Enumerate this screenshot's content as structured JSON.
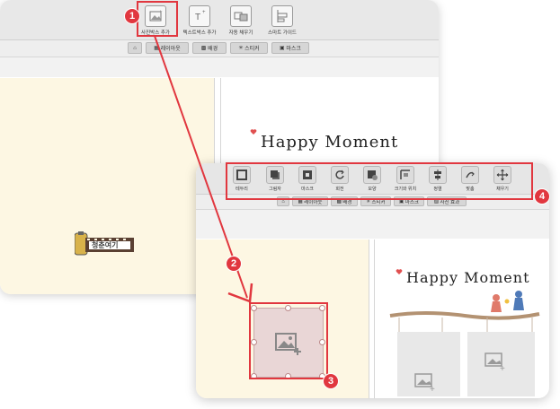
{
  "back_window": {
    "tools": [
      {
        "label": "사진박스 추가",
        "icon": "image-add-icon"
      },
      {
        "label": "텍스트박스 추가",
        "icon": "text-add-icon"
      },
      {
        "label": "자동 채우기",
        "icon": "autofill-icon"
      },
      {
        "label": "스마트 가이드",
        "icon": "smart-guide-icon"
      }
    ],
    "tabs": [
      {
        "label": "레이아웃",
        "icon": "layout-icon"
      },
      {
        "label": "배경",
        "icon": "background-icon"
      },
      {
        "label": "스티커",
        "icon": "sticker-icon"
      },
      {
        "label": "마스크",
        "icon": "mask-icon"
      }
    ],
    "page_title": "Happy Moment",
    "sticker_text": "청춘여기"
  },
  "front_window": {
    "tools": [
      {
        "label": "테두리",
        "icon": "border-icon"
      },
      {
        "label": "그림자",
        "icon": "shadow-icon"
      },
      {
        "label": "마스크",
        "icon": "mask-icon"
      },
      {
        "label": "회전",
        "icon": "rotate-icon"
      },
      {
        "label": "모양",
        "icon": "shape-icon"
      },
      {
        "label": "크기와 위치",
        "icon": "size-position-icon"
      },
      {
        "label": "정렬",
        "icon": "align-icon"
      },
      {
        "label": "맞춤",
        "icon": "fit-icon"
      },
      {
        "label": "채우기",
        "icon": "fill-icon"
      }
    ],
    "tabs": [
      {
        "label": "레이아웃",
        "icon": "layout-icon"
      },
      {
        "label": "배경",
        "icon": "background-icon"
      },
      {
        "label": "스티커",
        "icon": "sticker-icon"
      },
      {
        "label": "마스크",
        "icon": "mask-icon"
      },
      {
        "label": "사진 효과",
        "icon": "photo-effect-icon"
      }
    ],
    "page_title": "Happy Moment"
  },
  "callouts": [
    "1",
    "2",
    "3",
    "4"
  ],
  "colors": {
    "accent": "#e1373f",
    "panel": "#fdf7e3",
    "photo_box": "#e9d6d6"
  }
}
